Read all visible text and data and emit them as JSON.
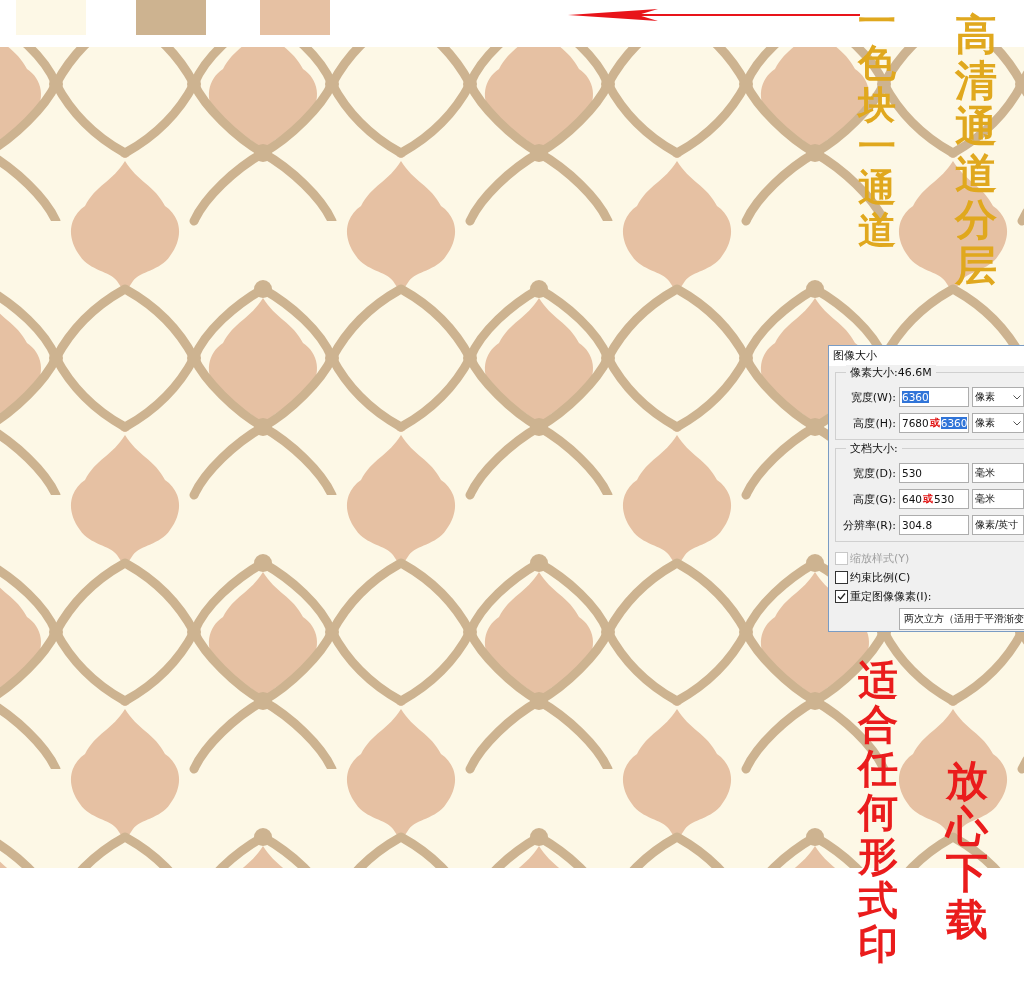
{
  "swatches": [
    {
      "color": "#fdf8e6"
    },
    {
      "color": "#cdb390"
    },
    {
      "color": "#e6c1a3"
    }
  ],
  "captions": [
    {
      "text": "一色块一通道",
      "kind": "gold"
    },
    {
      "text": "高清通道分层",
      "kind": "gold"
    },
    {
      "text": "适合任何形式印",
      "kind": "red"
    },
    {
      "text": "放心下载",
      "kind": "red"
    }
  ],
  "dialog": {
    "title": "图像大小",
    "groups": [
      {
        "title": "像素大小:46.6M",
        "rows": [
          {
            "label": "宽度(W):",
            "parts": [
              {
                "text": "6360",
                "kind": "selected"
              }
            ],
            "unit": "像素",
            "caret": true
          },
          {
            "label": "高度(H):",
            "parts": [
              {
                "text": "7680",
                "kind": "plain"
              },
              {
                "text": "或",
                "kind": "mark"
              },
              {
                "text": "6360",
                "kind": "selected"
              }
            ],
            "unit": "像素",
            "caret": true
          }
        ]
      },
      {
        "title": "文档大小:",
        "rows": [
          {
            "label": "宽度(D):",
            "parts": [
              {
                "text": "530",
                "kind": "plain"
              }
            ],
            "unit": "毫米",
            "caret": false
          },
          {
            "label": "高度(G):",
            "parts": [
              {
                "text": "640",
                "kind": "plain"
              },
              {
                "text": "或",
                "kind": "mark"
              },
              {
                "text": "530",
                "kind": "plain"
              }
            ],
            "unit": "毫米",
            "caret": false
          },
          {
            "label": "分辨率(R):",
            "parts": [
              {
                "text": "304.8",
                "kind": "plain"
              }
            ],
            "unit": "像素/英寸",
            "caret": false
          }
        ]
      }
    ],
    "checks": [
      {
        "label": "缩放样式(Y)",
        "checked": false,
        "disabled": true
      },
      {
        "label": "约束比例(C)",
        "checked": false,
        "disabled": false
      },
      {
        "label": "重定图像像素(I):",
        "checked": true,
        "disabled": false
      }
    ],
    "method": "两次立方（适用于平滑渐变"
  }
}
